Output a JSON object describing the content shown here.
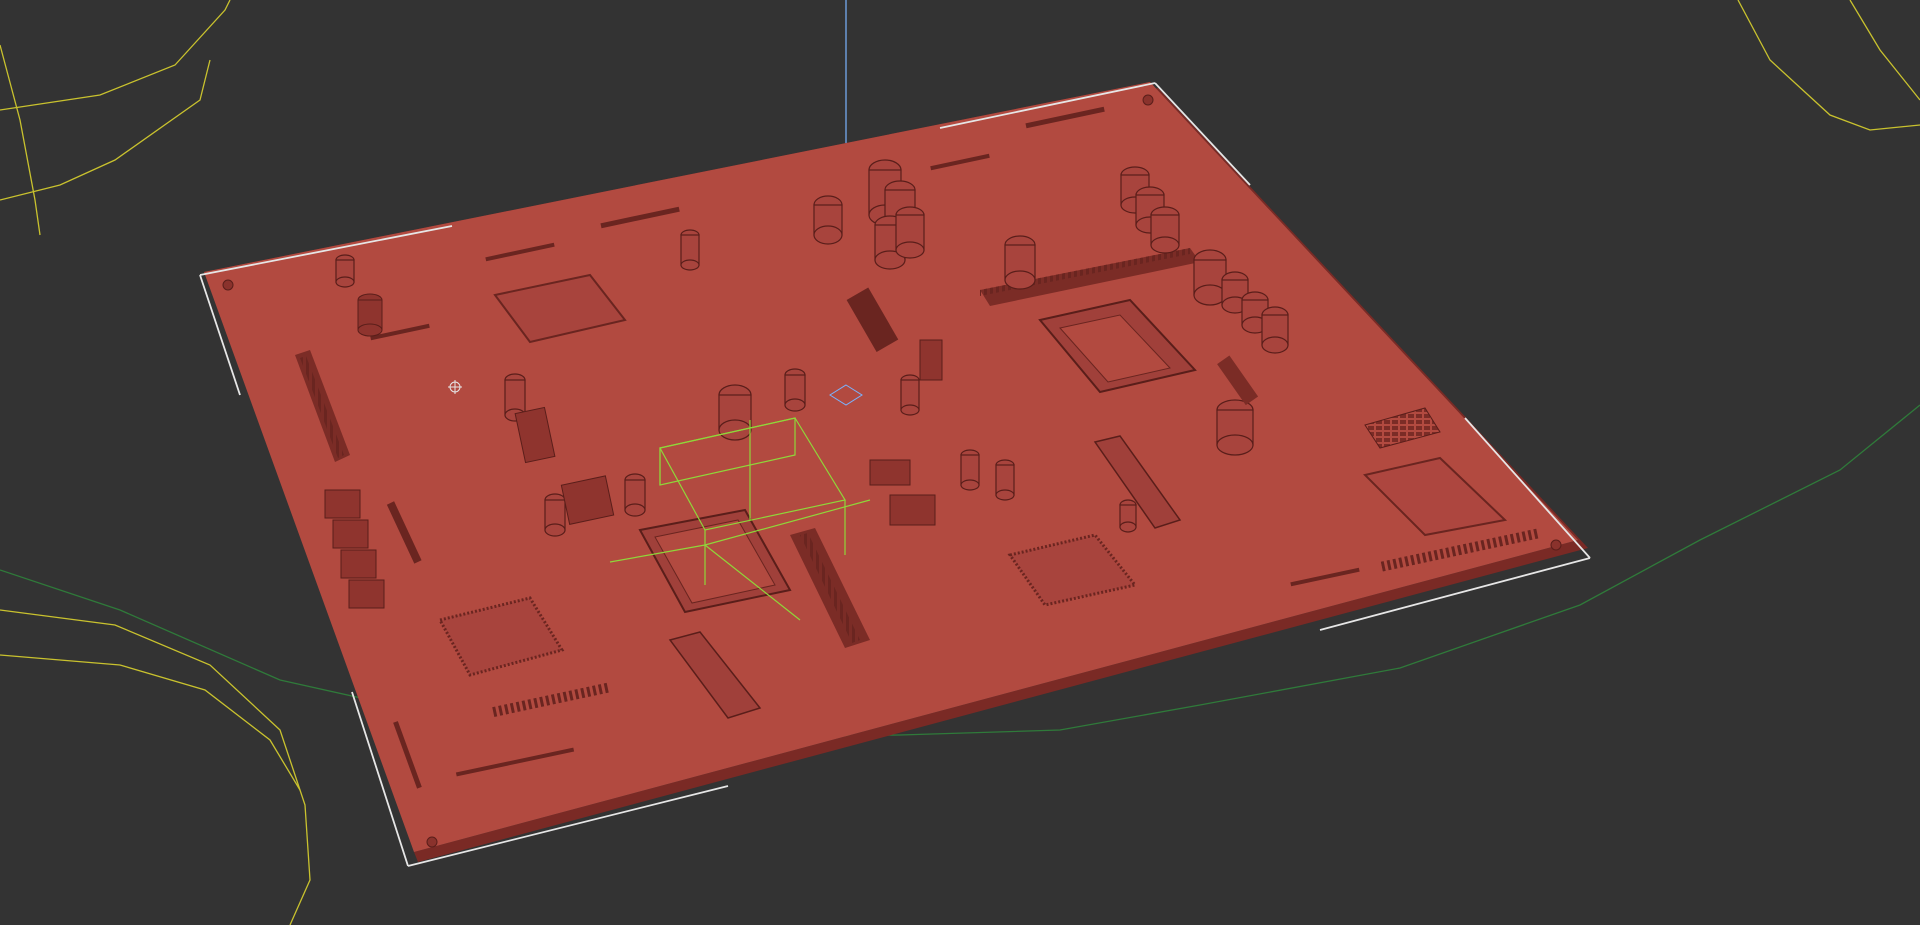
{
  "viewport": {
    "background": "#333333",
    "view": "perspective"
  },
  "scene": {
    "object": "circuit-board",
    "board_color": "#b24a40",
    "board_edge_color": "#7a2a25",
    "component_color": "#9c3b33",
    "component_shadow": "#5a1e1a",
    "selection_brackets_color": "#e6e6e6",
    "gizmo_color": "#8fd63a",
    "gizmo_axis_color": "#7ab4ff",
    "spline_color_yellow": "#c9c22e",
    "spline_color_green": "#2f7a3a",
    "pivot_icon": "pivot-crosshair-icon"
  }
}
